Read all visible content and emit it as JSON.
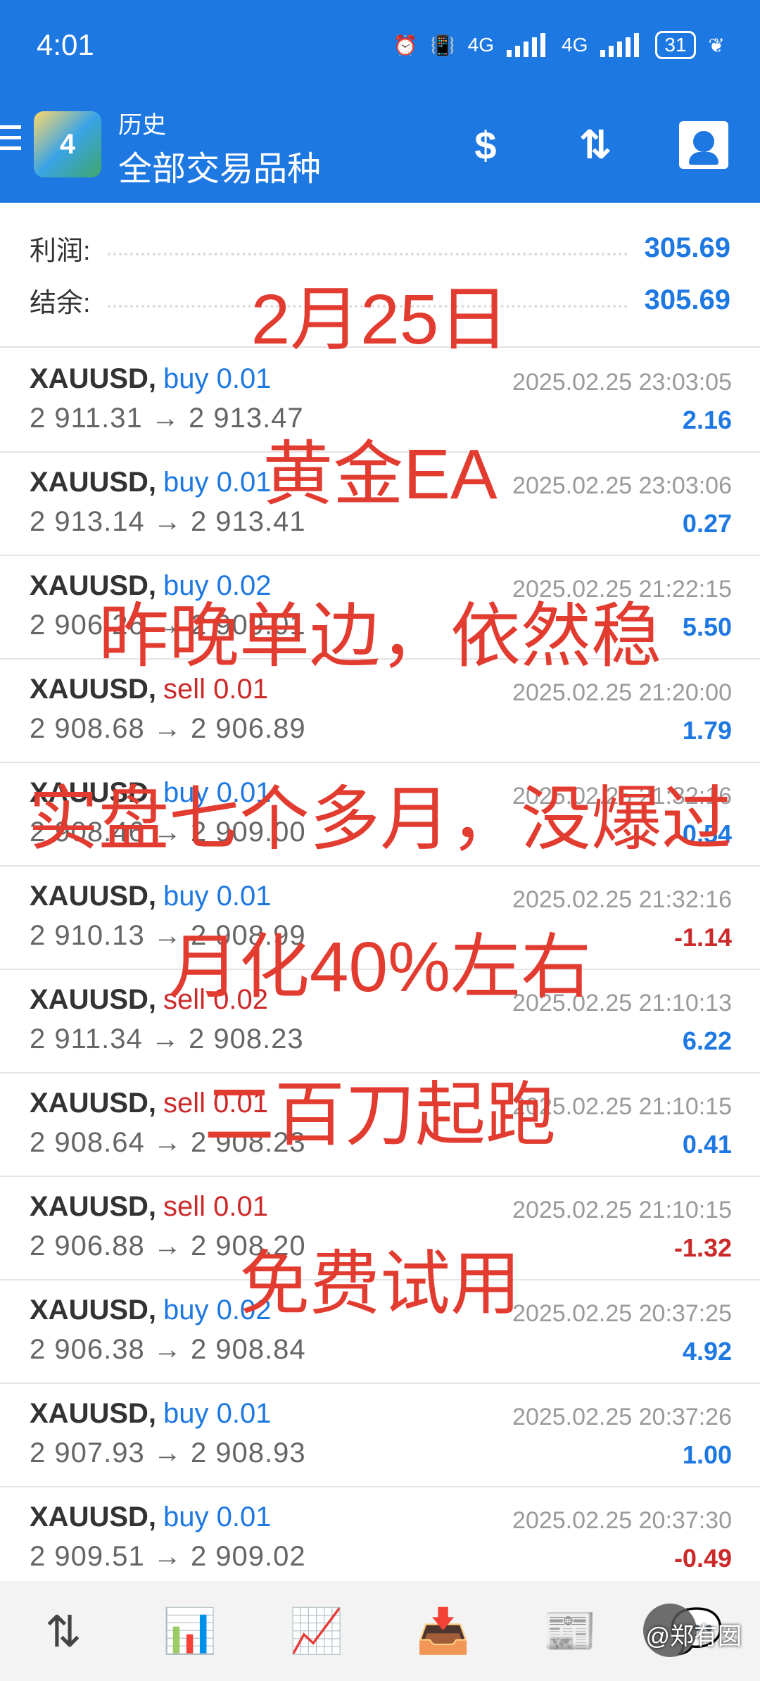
{
  "status_bar": {
    "time": "4:01",
    "net1": "4G",
    "net2": "4G",
    "battery": "31"
  },
  "app_bar": {
    "title": "历史",
    "subtitle": "全部交易品种",
    "logo_label": "4"
  },
  "summary": {
    "profit_label": "利润:",
    "profit_value": "305.69",
    "balance_label": "结余:",
    "balance_value": "305.69"
  },
  "trades": [
    {
      "symbol": "XAUUSD,",
      "type": "buy 0.01",
      "side": "buy",
      "open": "2 911.31",
      "close": "2 913.47",
      "time": "2025.02.25 23:03:05",
      "profit": "2.16"
    },
    {
      "symbol": "XAUUSD,",
      "type": "buy 0.01",
      "side": "buy",
      "open": "2 913.14",
      "close": "2 913.41",
      "time": "2025.02.25 23:03:06",
      "profit": "0.27"
    },
    {
      "symbol": "XAUUSD,",
      "type": "buy 0.02",
      "side": "buy",
      "open": "2 906.26",
      "close": "2 909.01",
      "time": "2025.02.25 21:22:15",
      "profit": "5.50"
    },
    {
      "symbol": "XAUUSD,",
      "type": "sell 0.01",
      "side": "sell",
      "open": "2 908.68",
      "close": "2 906.89",
      "time": "2025.02.25 21:20:00",
      "profit": "1.79"
    },
    {
      "symbol": "XAUUSD,",
      "type": "buy 0.01",
      "side": "buy",
      "open": "2 908.46",
      "close": "2 909.00",
      "time": "2025.02.25 21:32:16",
      "profit": "0.54"
    },
    {
      "symbol": "XAUUSD,",
      "type": "buy 0.01",
      "side": "buy",
      "open": "2 910.13",
      "close": "2 908.99",
      "time": "2025.02.25 21:32:16",
      "profit": "-1.14"
    },
    {
      "symbol": "XAUUSD,",
      "type": "sell 0.02",
      "side": "sell",
      "open": "2 911.34",
      "close": "2 908.23",
      "time": "2025.02.25 21:10:13",
      "profit": "6.22"
    },
    {
      "symbol": "XAUUSD,",
      "type": "sell 0.01",
      "side": "sell",
      "open": "2 908.64",
      "close": "2 908.23",
      "time": "2025.02.25 21:10:15",
      "profit": "0.41"
    },
    {
      "symbol": "XAUUSD,",
      "type": "sell 0.01",
      "side": "sell",
      "open": "2 906.88",
      "close": "2 908.20",
      "time": "2025.02.25 21:10:15",
      "profit": "-1.32"
    },
    {
      "symbol": "XAUUSD,",
      "type": "buy 0.02",
      "side": "buy",
      "open": "2 906.38",
      "close": "2 908.84",
      "time": "2025.02.25 20:37:25",
      "profit": "4.92"
    },
    {
      "symbol": "XAUUSD,",
      "type": "buy 0.01",
      "side": "buy",
      "open": "2 907.93",
      "close": "2 908.93",
      "time": "2025.02.25 20:37:26",
      "profit": "1.00"
    },
    {
      "symbol": "XAUUSD,",
      "type": "buy 0.01",
      "side": "buy",
      "open": "2 909.51",
      "close": "2 909.02",
      "time": "2025.02.25 20:37:30",
      "profit": "-0.49"
    }
  ],
  "overlay_text": [
    "2月25日",
    "黄金EA",
    "昨晚单边，依然稳",
    "实盘七个多月，没爆过",
    "月化40%左右",
    "二百刀起跑",
    "免费试用"
  ],
  "watermark": "@郑有囡",
  "colors": {
    "accent": "#1e78e2",
    "sell": "#cc2a2a",
    "overlay": "#e23b30"
  },
  "bottom_nav": [
    "quotes-icon",
    "chart-icon",
    "trade-icon",
    "history-icon",
    "news-icon",
    "messages-icon"
  ]
}
